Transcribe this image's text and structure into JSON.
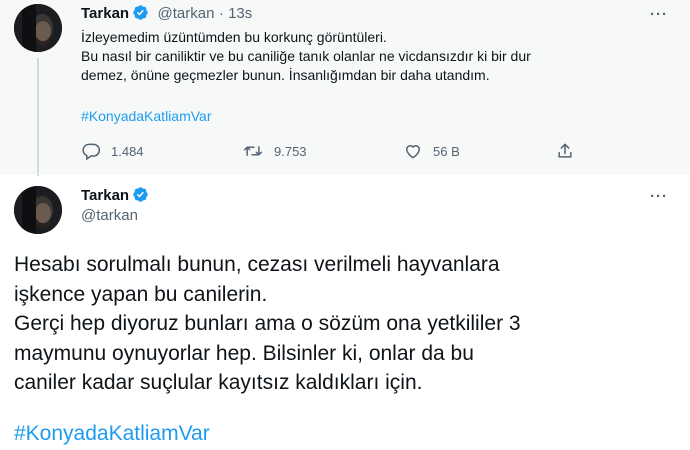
{
  "tweet1": {
    "name": "Tarkan",
    "handle": "@tarkan",
    "time": "· 13s",
    "more": "···",
    "line1": "İzleyemedim üzüntümden bu korkunç görüntüleri.",
    "line2": "Bu nasıl bir caniliktir ve bu caniliğe tanık olanlar ne vicdansızdır ki bir dur",
    "line3": "demez, önüne geçmezler bunun. İnsanlığımdan bir daha utandım.",
    "hashtag": "#KonyadaKatliamVar",
    "actions": {
      "replies": "1.484",
      "retweets": "9.753",
      "likes": "56 B"
    }
  },
  "tweet2": {
    "name": "Tarkan",
    "handle": "@tarkan",
    "more": "···",
    "line1": "Hesabı sorulmalı bunun, cezası verilmeli hayvanlara",
    "line2": "işkence yapan bu canilerin.",
    "line3": "Gerçi hep diyoruz bunları ama o sözüm ona yetkililer 3",
    "line4": "maymunu oynuyorlar hep. Bilsinler ki, onlar da bu",
    "line5": "caniler kadar suçlular kayıtsız kaldıkları için.",
    "hashtag": "#KonyadaKatliamVar"
  },
  "colors": {
    "accent": "#1d9bf0",
    "text": "#0f1419",
    "secondary": "#536471",
    "background_highlight": "#f7f9f9"
  },
  "icons": [
    "verified-badge-icon",
    "reply-icon",
    "retweet-icon",
    "like-icon",
    "share-icon",
    "more-icon"
  ]
}
